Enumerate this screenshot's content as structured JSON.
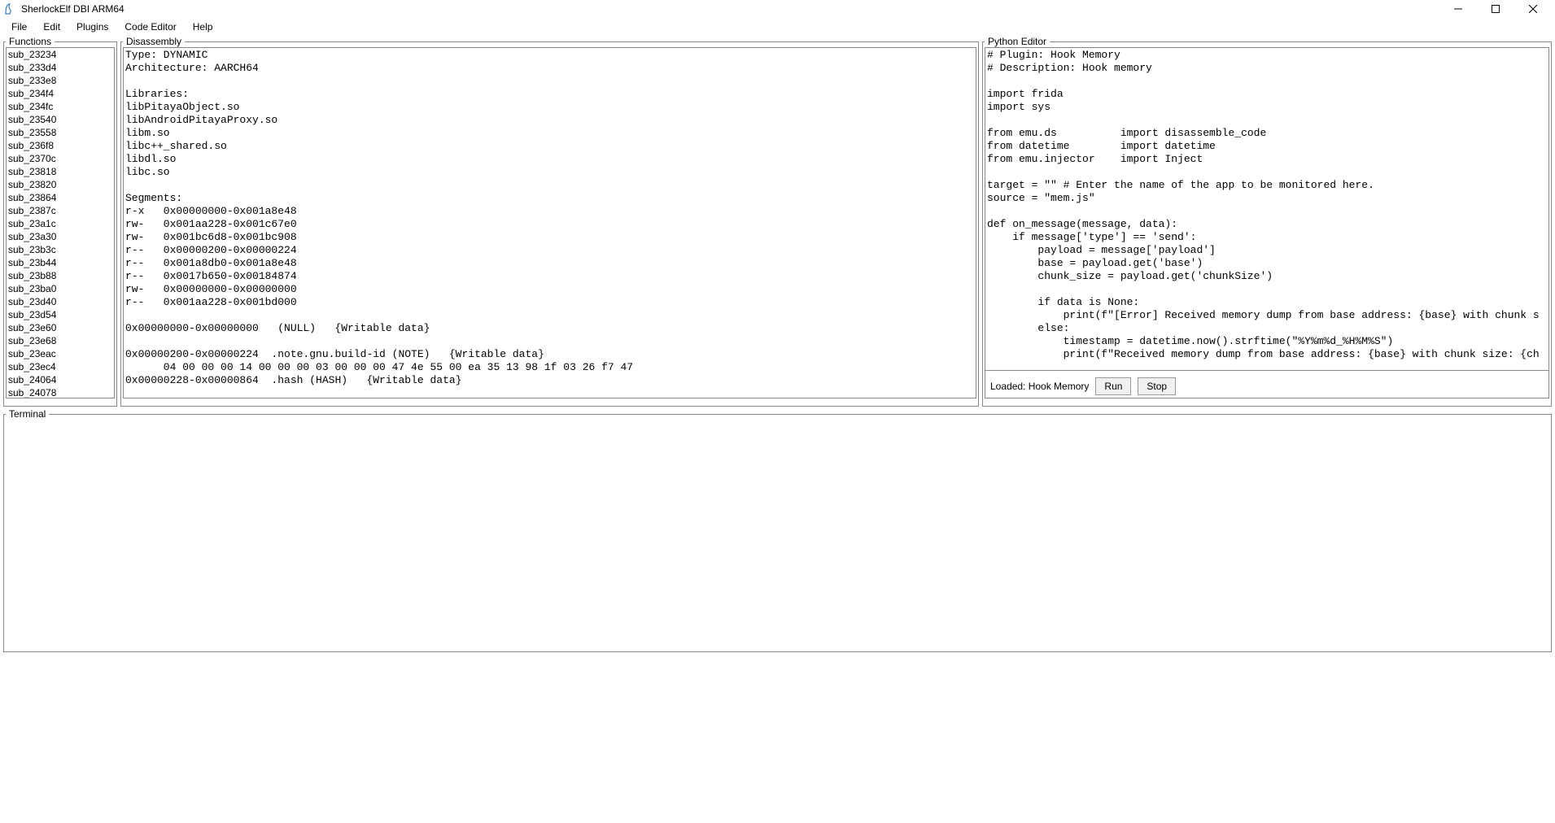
{
  "window": {
    "title": "SherlockElf DBI ARM64"
  },
  "menu": {
    "items": [
      "File",
      "Edit",
      "Plugins",
      "Code Editor",
      "Help"
    ]
  },
  "panels": {
    "functions": {
      "title": "Functions",
      "items": [
        "sub_23234",
        "sub_233d4",
        "sub_233e8",
        "sub_234f4",
        "sub_234fc",
        "sub_23540",
        "sub_23558",
        "sub_236f8",
        "sub_2370c",
        "sub_23818",
        "sub_23820",
        "sub_23864",
        "sub_2387c",
        "sub_23a1c",
        "sub_23a30",
        "sub_23b3c",
        "sub_23b44",
        "sub_23b88",
        "sub_23ba0",
        "sub_23d40",
        "sub_23d54",
        "sub_23e60",
        "sub_23e68",
        "sub_23eac",
        "sub_23ec4",
        "sub_24064",
        "sub_24078"
      ]
    },
    "disasm": {
      "title": "Disassembly",
      "text": "Type: DYNAMIC\nArchitecture: AARCH64\n\nLibraries:\nlibPitayaObject.so\nlibAndroidPitayaProxy.so\nlibm.so\nlibc++_shared.so\nlibdl.so\nlibc.so\n\nSegments:\nr-x   0x00000000-0x001a8e48\nrw-   0x001aa228-0x001c67e0\nrw-   0x001bc6d8-0x001bc908\nr--   0x00000200-0x00000224\nr--   0x001a8db0-0x001a8e48\nr--   0x0017b650-0x00184874\nrw-   0x00000000-0x00000000\nr--   0x001aa228-0x001bd000\n\n0x00000000-0x00000000   (NULL)   {Writable data}\n\n0x00000200-0x00000224  .note.gnu.build-id (NOTE)   {Writable data}\n      04 00 00 00 14 00 00 00 03 00 00 00 47 4e 55 00 ea 35 13 98 1f 03 26 f7 47\n0x00000228-0x00000864  .hash (HASH)   {Writable data}"
    },
    "editor": {
      "title": "Python Editor",
      "code": "# Plugin: Hook Memory\n# Description: Hook memory\n\nimport frida\nimport sys\n\nfrom emu.ds          import disassemble_code\nfrom datetime        import datetime\nfrom emu.injector    import Inject\n\ntarget = \"\" # Enter the name of the app to be monitored here.\nsource = \"mem.js\"\n\ndef on_message(message, data):\n    if message['type'] == 'send':\n        payload = message['payload']\n        base = payload.get('base')\n        chunk_size = payload.get('chunkSize')\n\n        if data is None:\n            print(f\"[Error] Received memory dump from base address: {base} with chunk s\n        else:\n            timestamp = datetime.now().strftime(\"%Y%m%d_%H%M%S\")\n            print(f\"Received memory dump from base address: {base} with chunk size: {ch",
      "status": "Loaded: Hook Memory",
      "run_label": "Run",
      "stop_label": "Stop"
    },
    "terminal": {
      "title": "Terminal",
      "text": ""
    }
  }
}
